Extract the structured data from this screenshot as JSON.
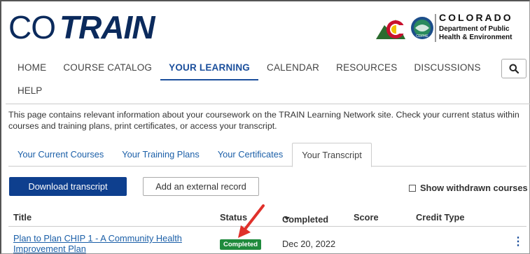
{
  "brand": {
    "co": "CO",
    "train": "TRAIN"
  },
  "agency": {
    "state": "COLORADO",
    "dept_line1": "Department of Public",
    "dept_line2": "Health & Environment",
    "seal_text": "CDPHE"
  },
  "nav": {
    "items": [
      "HOME",
      "COURSE CATALOG",
      "YOUR LEARNING",
      "CALENDAR",
      "RESOURCES",
      "DISCUSSIONS"
    ],
    "second_row": "HELP",
    "active": "YOUR LEARNING"
  },
  "intro": "This page contains relevant information about your coursework on the TRAIN Learning Network site. Check your current status within courses and training plans, print certificates, or access your transcript.",
  "tabs": [
    "Your Current Courses",
    "Your Training Plans",
    "Your Certificates",
    "Your Transcript"
  ],
  "actions": {
    "download": "Download transcript",
    "add_record": "Add an external record",
    "show_withdrawn": "Show withdrawn courses"
  },
  "table": {
    "headers": {
      "title": "Title",
      "status": "Status",
      "completed": "Completed",
      "score": "Score",
      "credit_type": "Credit Type"
    },
    "rows": [
      {
        "title": "Plan to Plan CHIP 1 - A Community Health Improvement Plan",
        "status": "Completed",
        "completed": "Dec 20, 2022",
        "score": "",
        "credit_type": ""
      }
    ]
  },
  "colors": {
    "brand_navy": "#0b2a5c",
    "link_blue": "#1b5fa8",
    "primary_btn": "#0e3f8e",
    "status_green": "#1f8a3c",
    "annotation_red": "#e0312b"
  }
}
